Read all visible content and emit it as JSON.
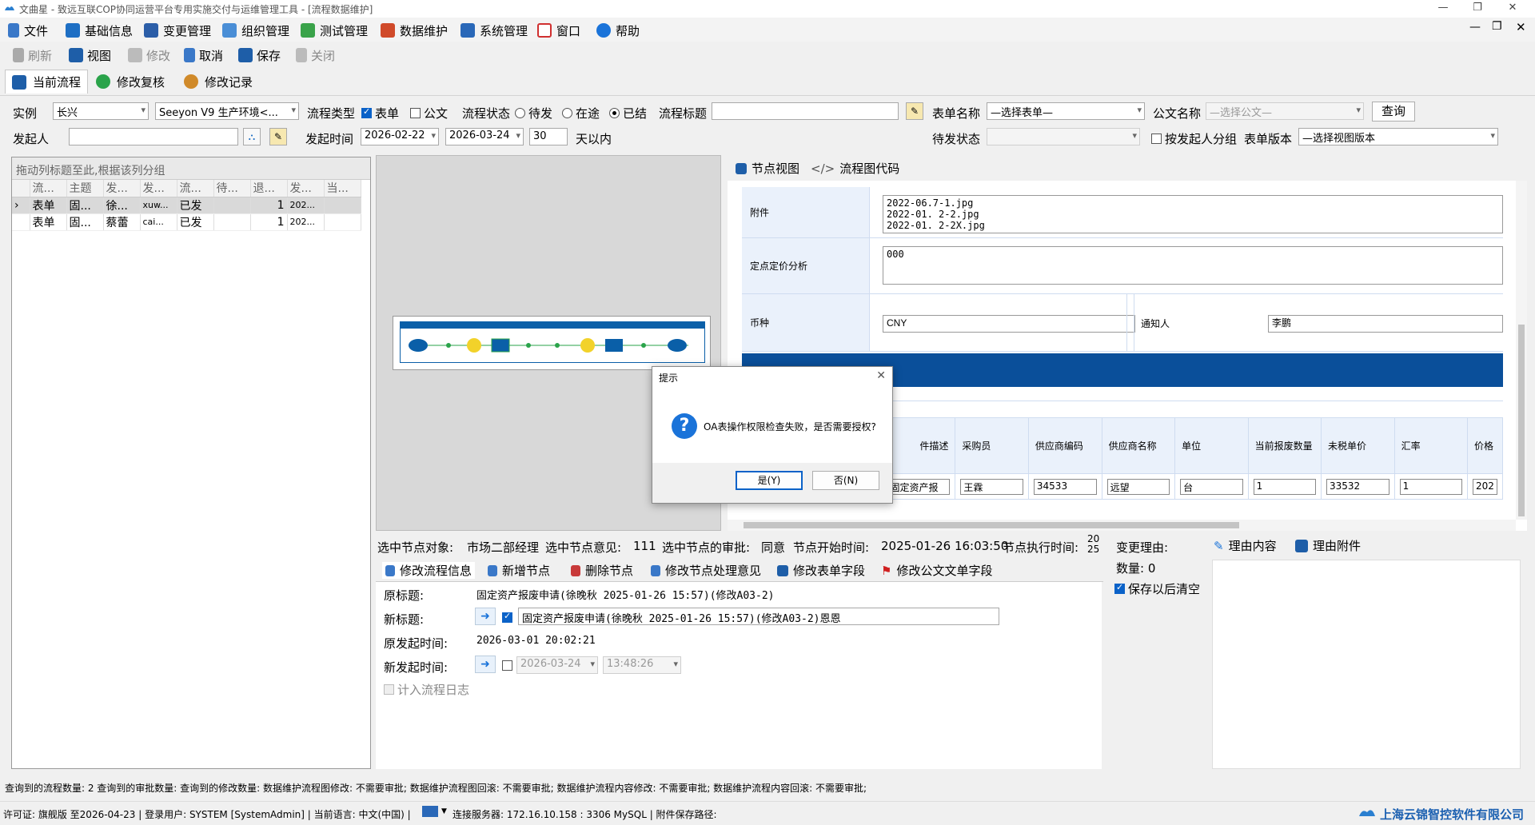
{
  "window": {
    "title": "文曲星 - 致远互联COP协同运营平台专用实施交付与运维管理工具 - [流程数据维护]"
  },
  "menu": [
    "文件",
    "基础信息",
    "变更管理",
    "组织管理",
    "测试管理",
    "数据维护",
    "系统管理",
    "窗口",
    "帮助"
  ],
  "toolbar": {
    "refresh": "刷新",
    "view": "视图",
    "modify": "修改",
    "cancel": "取消",
    "save": "保存",
    "close": "关闭"
  },
  "tabs": {
    "current_flow": "当前流程",
    "modify_review": "修改复核",
    "modify_record": "修改记录"
  },
  "filters": {
    "instance_label": "实例",
    "instance_value": "长兴",
    "env_value": "Seeyon V9 生产环境<...",
    "flow_type_label": "流程类型",
    "form_label": "表单",
    "doc_label": "公文",
    "flow_status_label": "流程状态",
    "pending_label": "待发",
    "inprogress_label": "在途",
    "finished_label": "已结",
    "flow_title_label": "流程标题",
    "flow_title_value": "",
    "form_name_label": "表单名称",
    "form_name_value": "—选择表单—",
    "doc_name_label": "公文名称",
    "doc_name_value": "—选择公文—",
    "query_button": "查询",
    "initiator_label": "发起人",
    "initiator_value": "",
    "start_time_label": "发起时间",
    "date_from": "2026-02-22",
    "date_to": "2026-03-24",
    "days_value": "30",
    "days_suffix": "天以内",
    "pending_status_label": "待发状态",
    "group_by_initiator_label": "按发起人分组",
    "form_version_label": "表单版本",
    "form_version_value": "—选择视图版本"
  },
  "grid": {
    "group_hint": "拖动列标题至此,根据该列分组",
    "columns": [
      "流...",
      "主题",
      "发...",
      "发...",
      "流...",
      "待...",
      "退...",
      "发...",
      "当..."
    ],
    "rows": [
      [
        "表单",
        "固...",
        "徐...",
        "xuw...",
        "已发",
        "",
        "1",
        "202...",
        ""
      ],
      [
        "表单",
        "固...",
        "蔡蕾",
        "cai...",
        "已发",
        "",
        "1",
        "202...",
        ""
      ]
    ]
  },
  "right_tabs": {
    "node_view": "节点视图",
    "flow_code": "流程图代码"
  },
  "form": {
    "attachment_label": "附件",
    "attachments": [
      "2022-06.7-1.jpg",
      "2022-01. 2-2.jpg",
      "2022-01. 2-2X.jpg"
    ],
    "pricing_label": "定点定价分析",
    "pricing_value": "000",
    "currency_label": "币种",
    "currency_value": "CNY",
    "notify_label": "通知人",
    "notify_value": "李鹏",
    "sub_headers": [
      "件描述",
      "采购员",
      "供应商编码",
      "供应商名称",
      "单位",
      "当前报废数量",
      "未税单价",
      "汇率",
      "价格"
    ],
    "sub_row": [
      "固定资产报",
      "王霖",
      "34533",
      "远望",
      "台",
      "1",
      "33532",
      "1",
      "202"
    ]
  },
  "dialog": {
    "title": "提示",
    "message": "OA表操作权限检查失败，是否需要授权?",
    "yes": "是(Y)",
    "no": "否(N)"
  },
  "info": {
    "node_obj_label": "选中节点对象:",
    "node_obj_value": "市场二部经理",
    "node_opinion_label": "选中节点意见:",
    "node_opinion_value": "111",
    "node_approve_label": "选中节点的审批:",
    "node_approve_value": "同意",
    "node_start_label": "节点开始时间:",
    "node_start_value": "2025-01-26 16:03:50",
    "node_exec_label": "节点执行时间:",
    "node_exec_value": "20 25"
  },
  "bottom_tabs": [
    "修改流程信息",
    "新增节点",
    "删除节点",
    "修改节点处理意见",
    "修改表单字段",
    "修改公文文单字段"
  ],
  "edit": {
    "orig_title_label": "原标题:",
    "orig_title_value": "固定资产报废申请(徐晚秋 2025-01-26 15:57)(修改A03-2)",
    "new_title_label": "新标题:",
    "new_title_value": "固定资产报废申请(徐晚秋 2025-01-26 15:57)(修改A03-2)恩恩",
    "orig_time_label": "原发起时间:",
    "orig_time_value": "2026-03-01 20:02:21",
    "new_time_label": "新发起时间:",
    "new_date_value": "2026-03-24",
    "new_clock_value": "13:48:26",
    "log_label": "计入流程日志"
  },
  "side": {
    "reason_label": "变更理由:",
    "count_label": "数量: 0",
    "clear_label": "保存以后清空"
  },
  "reason_tabs": {
    "content": "理由内容",
    "attachment": "理由附件"
  },
  "status1": "查询到的流程数量:  2 查询到的审批数量:  查询到的修改数量:  数据维护流程图修改:  不需要审批;  数据维护流程图回滚:  不需要审批;  数据维护流程内容修改:  不需要审批;  数据维护流程内容回滚:  不需要审批;",
  "status2": {
    "license": "许可证:  旗舰版 至2026-04-23 | 登录用户:  SYSTEM [SystemAdmin] | 当前语言:  中文(中国) |",
    "server": "连接服务器:  172.16.10.158 : 3306 MySQL | 附件保存路径:",
    "company": "上海云锦智控软件有限公司"
  }
}
